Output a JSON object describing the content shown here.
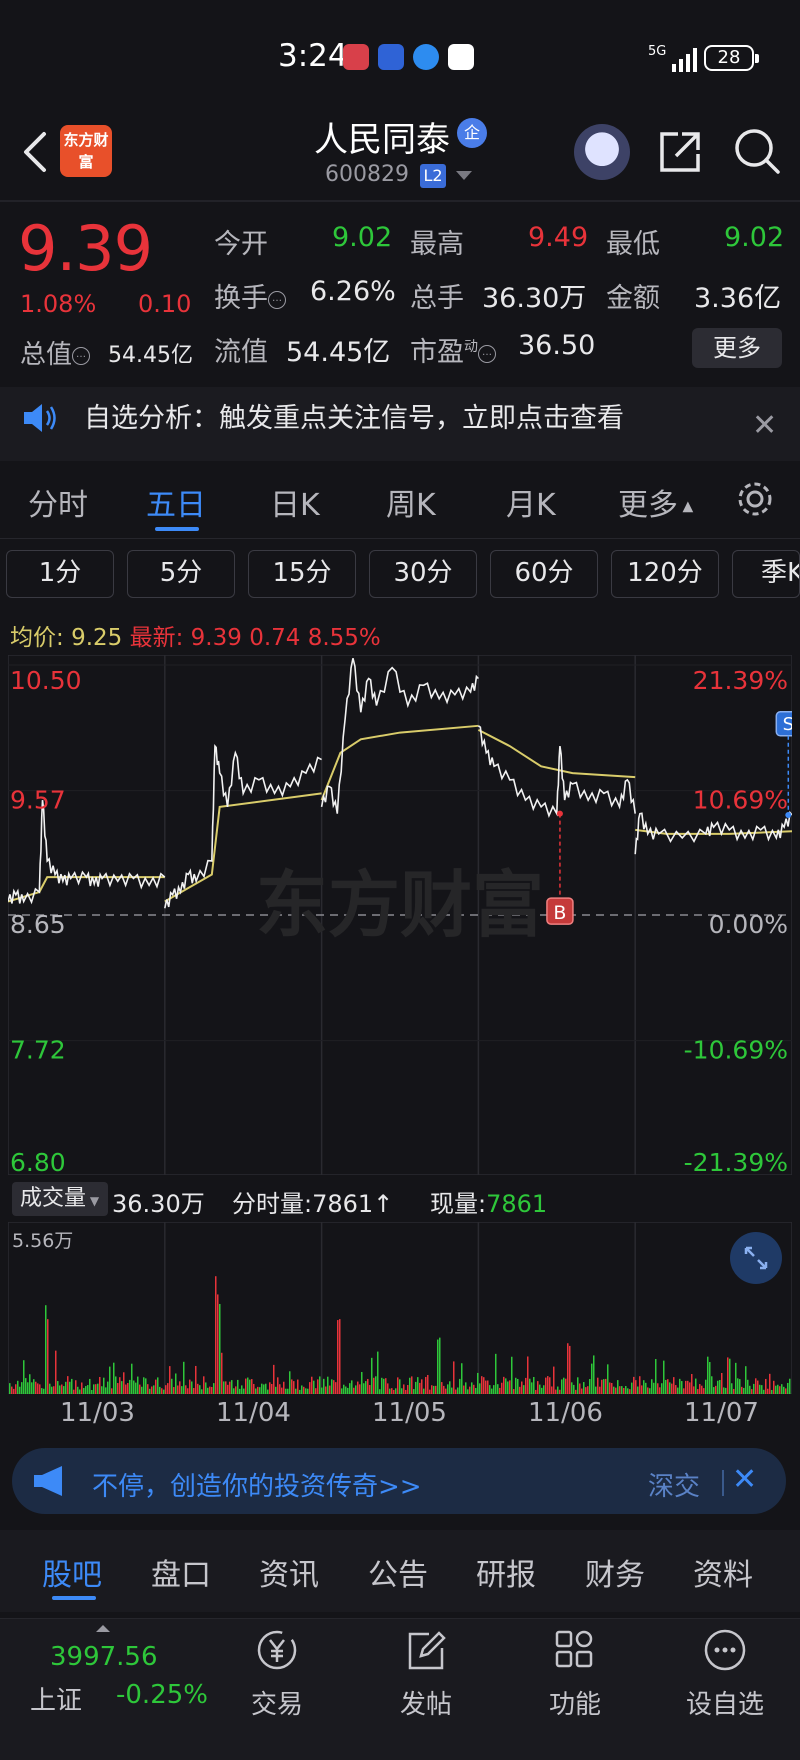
{
  "status_bar": {
    "time": "3:24",
    "network": "5G",
    "battery": "28"
  },
  "header": {
    "logo_text": "东方财富",
    "stock_name": "人民同泰",
    "badge": "企",
    "stock_code": "600829",
    "level_badge": "L2"
  },
  "quote": {
    "price": "9.39",
    "change_pct": "1.08%",
    "change_val": "0.10",
    "market_cap_label": "总值",
    "market_cap": "54.45亿",
    "open_label": "今开",
    "open": "9.02",
    "high_label": "最高",
    "high": "9.49",
    "low_label": "最低",
    "low": "9.02",
    "turnover_label": "换手",
    "turnover": "6.26%",
    "volume_label": "总手",
    "volume": "36.30万",
    "amount_label": "金额",
    "amount": "3.36亿",
    "float_cap_label": "流值",
    "float_cap": "54.45亿",
    "pe_label": "市盈",
    "pe_sup": "动",
    "pe": "36.50",
    "more": "更多"
  },
  "notice": {
    "text": "自选分析：触发重点关注信号，立即点击查看",
    "close": "✕"
  },
  "period_tabs": [
    "分时",
    "五日",
    "日K",
    "周K",
    "月K",
    "更多"
  ],
  "active_period": "五日",
  "intervals": [
    "1分",
    "5分",
    "15分",
    "30分",
    "60分",
    "120分",
    "季K"
  ],
  "avg_bar": {
    "avg_label": "均价:",
    "avg": "9.25",
    "latest_label": "最新:",
    "latest": "9.39",
    "change": "0.74",
    "pct": "8.55%"
  },
  "chart_data": {
    "type": "line",
    "price_axis": [
      "10.50",
      "9.57",
      "8.65",
      "7.72",
      "6.80"
    ],
    "pct_axis": [
      "21.39%",
      "10.69%",
      "0.00%",
      "-10.69%",
      "-21.39%"
    ],
    "prev_close": 8.65,
    "ylim": [
      6.8,
      10.5
    ],
    "days": [
      "11/03",
      "11/04",
      "11/05",
      "11/06",
      "11/07"
    ],
    "markers": [
      {
        "label": "B",
        "day": "11/06"
      },
      {
        "label": "S",
        "day": "11/07"
      }
    ],
    "price_points": [
      [
        [
          0,
          8.75
        ],
        [
          0.05,
          8.8
        ],
        [
          0.1,
          8.75
        ],
        [
          0.2,
          8.82
        ],
        [
          0.22,
          9.5
        ],
        [
          0.25,
          9.05
        ],
        [
          0.3,
          8.95
        ],
        [
          0.35,
          8.9
        ],
        [
          0.4,
          8.92
        ],
        [
          0.5,
          8.93
        ],
        [
          0.55,
          8.88
        ],
        [
          0.6,
          8.92
        ],
        [
          0.7,
          8.9
        ],
        [
          0.8,
          8.92
        ],
        [
          0.9,
          8.87
        ],
        [
          1.0,
          8.93
        ]
      ],
      [
        [
          0,
          8.7
        ],
        [
          0.05,
          8.8
        ],
        [
          0.1,
          8.82
        ],
        [
          0.15,
          8.95
        ],
        [
          0.2,
          8.9
        ],
        [
          0.3,
          9.05
        ],
        [
          0.32,
          9.9
        ],
        [
          0.35,
          9.7
        ],
        [
          0.4,
          9.45
        ],
        [
          0.45,
          9.85
        ],
        [
          0.5,
          9.55
        ],
        [
          0.6,
          9.65
        ],
        [
          0.7,
          9.55
        ],
        [
          0.8,
          9.6
        ],
        [
          0.9,
          9.7
        ],
        [
          1.0,
          9.8
        ]
      ],
      [
        [
          0,
          9.45
        ],
        [
          0.05,
          9.6
        ],
        [
          0.1,
          9.4
        ],
        [
          0.15,
          10.1
        ],
        [
          0.2,
          10.55
        ],
        [
          0.25,
          10.15
        ],
        [
          0.3,
          10.4
        ],
        [
          0.35,
          10.2
        ],
        [
          0.45,
          10.48
        ],
        [
          0.55,
          10.2
        ],
        [
          0.65,
          10.35
        ],
        [
          0.75,
          10.25
        ],
        [
          0.85,
          10.28
        ],
        [
          0.95,
          10.3
        ],
        [
          1.0,
          10.4
        ]
      ],
      [
        [
          0,
          10.05
        ],
        [
          0.05,
          9.85
        ],
        [
          0.1,
          9.75
        ],
        [
          0.2,
          9.65
        ],
        [
          0.3,
          9.5
        ],
        [
          0.4,
          9.45
        ],
        [
          0.5,
          9.4
        ],
        [
          0.52,
          9.9
        ],
        [
          0.55,
          9.5
        ],
        [
          0.6,
          9.62
        ],
        [
          0.7,
          9.5
        ],
        [
          0.8,
          9.55
        ],
        [
          0.9,
          9.45
        ],
        [
          0.95,
          9.65
        ],
        [
          1.0,
          9.4
        ]
      ],
      [
        [
          0,
          9.1
        ],
        [
          0.03,
          9.4
        ],
        [
          0.08,
          9.25
        ],
        [
          0.15,
          9.25
        ],
        [
          0.3,
          9.22
        ],
        [
          0.45,
          9.25
        ],
        [
          0.5,
          9.3
        ],
        [
          0.6,
          9.28
        ],
        [
          0.7,
          9.22
        ],
        [
          0.8,
          9.28
        ],
        [
          0.9,
          9.22
        ],
        [
          0.95,
          9.3
        ],
        [
          1.0,
          9.39
        ]
      ]
    ],
    "avg_points": [
      [
        [
          0,
          8.75
        ],
        [
          0.2,
          8.82
        ],
        [
          0.25,
          8.93
        ],
        [
          1.0,
          8.93
        ]
      ],
      [
        [
          0,
          8.75
        ],
        [
          0.3,
          8.95
        ],
        [
          0.35,
          9.45
        ],
        [
          1.0,
          9.55
        ]
      ],
      [
        [
          0,
          9.5
        ],
        [
          0.12,
          9.85
        ],
        [
          0.25,
          9.95
        ],
        [
          0.5,
          10.0
        ],
        [
          1.0,
          10.05
        ]
      ],
      [
        [
          0,
          10.02
        ],
        [
          0.2,
          9.9
        ],
        [
          0.4,
          9.75
        ],
        [
          0.6,
          9.7
        ],
        [
          1.0,
          9.67
        ]
      ],
      [
        [
          0,
          9.28
        ],
        [
          0.2,
          9.25
        ],
        [
          0.6,
          9.25
        ],
        [
          1.0,
          9.27
        ]
      ]
    ]
  },
  "volume": {
    "selector": "成交量",
    "total": "36.30万",
    "tick_label": "分时量:",
    "tick_value": "7861",
    "tick_arrow": "↑",
    "current_label": "现量:",
    "current_value": "7861",
    "max_label": "5.56万"
  },
  "ad": {
    "text": "不停，创造你的投资传奇>>",
    "right": "深交",
    "close": "✕"
  },
  "info_tabs": [
    "股吧",
    "盘口",
    "资讯",
    "公告",
    "研报",
    "财务",
    "资料"
  ],
  "active_info_tab": "股吧",
  "bottom_nav": {
    "index_value": "3997.56",
    "index_name": "上证",
    "index_change": "-0.25%",
    "items": [
      {
        "label": "交易",
        "icon": "yen-icon"
      },
      {
        "label": "发帖",
        "icon": "edit-icon"
      },
      {
        "label": "功能",
        "icon": "grid-icon"
      },
      {
        "label": "设自选",
        "icon": "dots-icon"
      }
    ]
  },
  "colors": {
    "up": "#e8333a",
    "down": "#2ec73a",
    "accent": "#3d8af7",
    "avg": "#d9cc6a"
  }
}
